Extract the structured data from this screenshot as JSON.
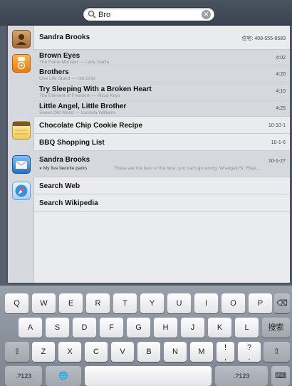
{
  "search": {
    "value": "Bro",
    "clear_glyph": "✕"
  },
  "results": {
    "contact_top": {
      "name": "Sandra Brooks",
      "detail": "住宅: 408-555-8583"
    },
    "music": [
      {
        "title": "Brown Eyes",
        "subtitle": "The Fame Monster — Lady GaGa",
        "duration": "4:02"
      },
      {
        "title": "Brothers",
        "subtitle": "One Life Stand — Hot Chip",
        "duration": "4:20"
      },
      {
        "title": "Try Sleeping With a Broken Heart",
        "subtitle": "The Element of Freedom — Alicia Keys",
        "duration": "4:10"
      },
      {
        "title": "Little Angel, Little Brother",
        "subtitle": "Sweet Old World — Lucinda Williams",
        "duration": "4:25"
      }
    ],
    "notes": [
      {
        "title": "Chocolate Chip Cookie Recipe",
        "date": "10-10-1"
      },
      {
        "title": "BBQ Shopping List",
        "date": "10-1-6"
      }
    ],
    "mail": {
      "sender": "Sandra Brooks",
      "subject": "My five favorite parks",
      "preview": "These are the best of the best, you can't go wrong. Wrangell-St. Elias...",
      "date": "10-1-27"
    },
    "safari": [
      {
        "title": "Search Web"
      },
      {
        "title": "Search Wikipedia"
      }
    ]
  },
  "keyboard": {
    "row1": [
      "Q",
      "W",
      "E",
      "R",
      "T",
      "Y",
      "U",
      "I",
      "O",
      "P"
    ],
    "row2": [
      "A",
      "S",
      "D",
      "F",
      "G",
      "H",
      "J",
      "K",
      "L"
    ],
    "row3": [
      "Z",
      "X",
      "C",
      "V",
      "B",
      "N",
      "M",
      "!",
      ",",
      "?",
      "."
    ],
    "return_label": "搜索",
    "numbers_label": ".?123",
    "shift_glyph": "⇧",
    "globe_glyph": "🌐",
    "delete_glyph": "⌫",
    "dismiss_glyph": "⌨"
  },
  "colors": {
    "panel_bg": "#e9ebee",
    "shaded_group": "#d5d8dd",
    "contacts_icon": "#c08a50",
    "music_icon": "#f29a2e",
    "notes_icon": "#f3d36b",
    "mail_icon": "#3f86d6",
    "safari_icon": "#3a8fd9"
  }
}
